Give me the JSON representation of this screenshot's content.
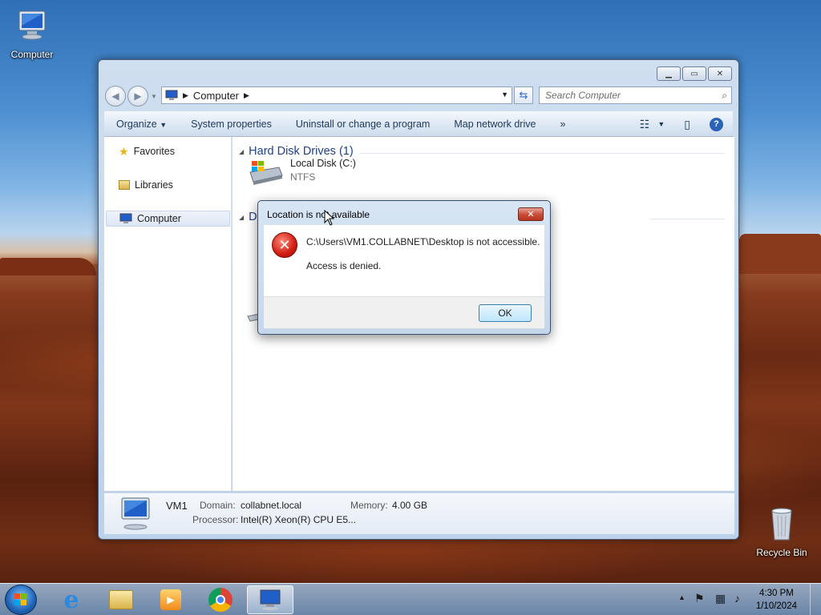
{
  "desktop": {
    "computer_label": "Computer",
    "recycle_label": "Recycle Bin"
  },
  "window": {
    "address_crumb": "Computer",
    "search_placeholder": "Search Computer",
    "toolbar": {
      "organize": "Organize",
      "system_properties": "System properties",
      "uninstall": "Uninstall or change a program",
      "map_drive": "Map network drive",
      "more": "»"
    },
    "nav": {
      "favorites": "Favorites",
      "libraries": "Libraries",
      "computer": "Computer"
    },
    "groups": {
      "hdd": "Hard Disk Drives (1)",
      "devices_partial": "D"
    },
    "drive": {
      "name": "Local Disk (C:)",
      "fs": "NTFS"
    },
    "details": {
      "name": "VM1",
      "domain_label": "Domain:",
      "domain_value": "collabnet.local",
      "memory_label": "Memory:",
      "memory_value": "4.00 GB",
      "processor_label": "Processor:",
      "processor_value": "Intel(R) Xeon(R) CPU E5..."
    }
  },
  "dialog": {
    "title": "Location is not available",
    "message": "C:\\Users\\VM1.COLLABNET\\Desktop is not accessible.",
    "detail": "Access is denied.",
    "ok": "OK"
  },
  "taskbar": {
    "time": "4:30 PM",
    "date": "1/10/2024",
    "pinned": [
      "internet-explorer-icon",
      "windows-explorer-icon",
      "media-player-icon",
      "chrome-icon",
      "computer-icon"
    ]
  }
}
